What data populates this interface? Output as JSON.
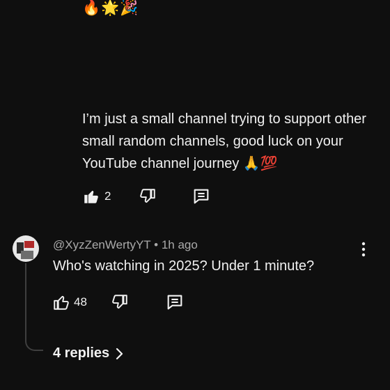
{
  "reply": {
    "emoji_line": "🔥🌟🎉",
    "text": "I’m just a small channel trying to support other small random channels, good luck on your YouTube channel journey 🙏💯",
    "like_count": "2"
  },
  "comment": {
    "author": "@XyzZenWertyYT",
    "separator": "•",
    "time": "1h ago",
    "text": "Who's watching in 2025? Under 1 minute?",
    "like_count": "48",
    "replies_label": "4 replies"
  },
  "icons": {
    "like_filled": "thumbs-up-filled-icon",
    "like_outline": "thumbs-up-outline-icon",
    "dislike": "thumbs-down-icon",
    "reply": "comment-reply-icon",
    "more": "more-vert-icon",
    "chevron": "chevron-right-icon"
  },
  "colors": {
    "background": "#0f0f0f",
    "text": "#f1f1f1",
    "secondary_text": "#aaaaaa"
  }
}
